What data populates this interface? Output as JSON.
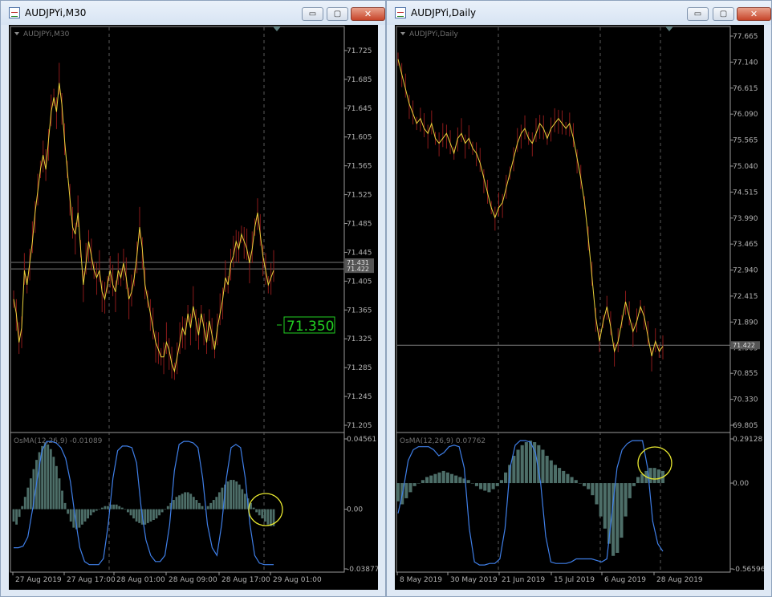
{
  "windows": [
    {
      "title": "AUDJPYi,M30",
      "label": "AUDJPYi,M30",
      "buttons": {
        "minimize": "▭",
        "maximize": "▢",
        "close": "✕"
      },
      "price_tag": "71.350",
      "chart_data": {
        "type": "line",
        "symbol": "AUDJPYi",
        "timeframe": "M30",
        "y_ticks": [
          "71.725",
          "71.685",
          "71.645",
          "71.605",
          "71.565",
          "71.525",
          "71.485",
          "71.445",
          "71.405",
          "71.365",
          "71.325",
          "71.285",
          "71.245",
          "71.205"
        ],
        "ylim": [
          71.205,
          71.745
        ],
        "x_ticks": [
          "27 Aug 2019",
          "27 Aug 17:00",
          "28 Aug 01:00",
          "28 Aug 09:00",
          "28 Aug 17:00",
          "29 Aug 01:00"
        ],
        "hlines": [
          {
            "value": 71.431,
            "label": "71.431"
          },
          {
            "value": 71.422,
            "label": "71.422"
          }
        ],
        "price_series": [
          71.38,
          71.36,
          71.32,
          71.34,
          71.42,
          71.4,
          71.43,
          71.46,
          71.5,
          71.53,
          71.56,
          71.58,
          71.56,
          71.6,
          71.64,
          71.66,
          71.64,
          71.68,
          71.65,
          71.6,
          71.56,
          71.52,
          71.48,
          71.47,
          71.5,
          71.45,
          71.4,
          71.43,
          71.46,
          71.44,
          71.42,
          71.41,
          71.42,
          71.39,
          71.38,
          71.4,
          71.42,
          71.4,
          71.39,
          71.42,
          71.41,
          71.43,
          71.41,
          71.38,
          71.39,
          71.41,
          71.44,
          71.48,
          71.45,
          71.4,
          71.38,
          71.36,
          71.34,
          71.32,
          71.31,
          71.3,
          71.3,
          71.32,
          71.31,
          71.29,
          71.28,
          71.3,
          71.32,
          71.34,
          71.33,
          71.36,
          71.34,
          71.37,
          71.35,
          71.33,
          71.36,
          71.34,
          71.32,
          71.35,
          71.33,
          71.31,
          71.34,
          71.36,
          71.38,
          71.41,
          71.4,
          71.43,
          71.44,
          71.46,
          71.45,
          71.47,
          71.46,
          71.45,
          71.43,
          71.45,
          71.48,
          71.5,
          71.47,
          71.44,
          71.42,
          71.4,
          71.41,
          71.42
        ],
        "osma": {
          "label": "OsMA(12,26,9) -0.01089",
          "y_ticks": [
            "0.04561",
            "0.00",
            "-0.03877"
          ],
          "ylim": [
            -0.03877,
            0.04561
          ],
          "histogram": [
            -0.008,
            -0.01,
            -0.005,
            0.002,
            0.008,
            0.014,
            0.02,
            0.026,
            0.032,
            0.037,
            0.041,
            0.043,
            0.042,
            0.039,
            0.034,
            0.028,
            0.02,
            0.012,
            0.004,
            -0.003,
            -0.008,
            -0.012,
            -0.013,
            -0.012,
            -0.01,
            -0.008,
            -0.006,
            -0.004,
            -0.002,
            -0.001,
            0.0,
            0.001,
            0.002,
            0.002,
            0.003,
            0.003,
            0.003,
            0.002,
            0.001,
            0.0,
            -0.002,
            -0.004,
            -0.006,
            -0.008,
            -0.009,
            -0.01,
            -0.01,
            -0.009,
            -0.008,
            -0.007,
            -0.006,
            -0.004,
            -0.002,
            0.0,
            0.002,
            0.004,
            0.006,
            0.008,
            0.009,
            0.01,
            0.011,
            0.011,
            0.01,
            0.008,
            0.006,
            0.004,
            0.002,
            0.0,
            0.002,
            0.004,
            0.006,
            0.008,
            0.011,
            0.014,
            0.016,
            0.018,
            0.019,
            0.019,
            0.018,
            0.016,
            0.013,
            0.01,
            0.007,
            0.004,
            0.001,
            -0.002,
            -0.004,
            -0.006,
            -0.008,
            -0.01,
            -0.011,
            -0.011
          ],
          "signal": [
            -0.025,
            -0.025,
            -0.024,
            -0.018,
            0.0,
            0.02,
            0.038,
            0.044,
            0.044,
            0.043,
            0.04,
            0.033,
            0.018,
            -0.005,
            -0.025,
            -0.034,
            -0.036,
            -0.036,
            -0.036,
            -0.032,
            -0.01,
            0.02,
            0.038,
            0.041,
            0.041,
            0.04,
            0.03,
            0.0,
            -0.02,
            -0.03,
            -0.034,
            -0.034,
            -0.03,
            -0.01,
            0.025,
            0.042,
            0.044,
            0.044,
            0.043,
            0.04,
            0.02,
            -0.01,
            -0.025,
            -0.03,
            -0.01,
            0.02,
            0.04,
            0.042,
            0.04,
            0.02,
            -0.01,
            -0.03,
            -0.035,
            -0.036,
            -0.036,
            -0.036
          ]
        }
      }
    },
    {
      "title": "AUDJPYi,Daily",
      "label": "AUDJPYi,Daily",
      "buttons": {
        "minimize": "▭",
        "maximize": "▢",
        "close": "✕"
      },
      "chart_data": {
        "type": "line",
        "symbol": "AUDJPYi",
        "timeframe": "Daily",
        "y_ticks": [
          "77.665",
          "77.140",
          "76.615",
          "76.090",
          "75.565",
          "75.040",
          "74.515",
          "73.990",
          "73.465",
          "72.940",
          "72.415",
          "71.890",
          "71.365",
          "70.855",
          "70.330",
          "69.805"
        ],
        "ylim": [
          69.805,
          77.665
        ],
        "x_ticks": [
          "8 May 2019",
          "30 May 2019",
          "21 Jun 2019",
          "15 Jul 2019",
          "6 Aug 2019",
          "28 Aug 2019"
        ],
        "hlines": [
          {
            "value": 71.422,
            "label": "71.422"
          }
        ],
        "price_series": [
          77.2,
          76.9,
          76.6,
          76.3,
          76.1,
          75.9,
          76.0,
          75.8,
          75.7,
          75.9,
          75.6,
          75.5,
          75.6,
          75.7,
          75.5,
          75.3,
          75.6,
          75.7,
          75.5,
          75.6,
          75.4,
          75.3,
          75.1,
          74.8,
          74.5,
          74.2,
          74.0,
          74.2,
          74.3,
          74.6,
          74.9,
          75.2,
          75.5,
          75.7,
          75.8,
          75.6,
          75.5,
          75.7,
          75.9,
          75.8,
          75.6,
          75.8,
          75.9,
          76.0,
          75.9,
          75.8,
          75.9,
          75.6,
          75.2,
          74.8,
          74.3,
          73.6,
          72.8,
          72.0,
          71.5,
          71.9,
          72.2,
          71.8,
          71.3,
          71.5,
          71.9,
          72.3,
          72.0,
          71.7,
          71.9,
          72.2,
          72.0,
          71.6,
          71.2,
          71.5,
          71.3,
          71.4
        ],
        "osma": {
          "label": "OsMA(12,26,9) 0.07762",
          "y_ticks": [
            "0.29128",
            "0.00",
            "-0.56596"
          ],
          "ylim": [
            -0.56596,
            0.29128
          ],
          "histogram": [
            -0.12,
            -0.14,
            -0.1,
            -0.06,
            -0.02,
            0.0,
            0.02,
            0.04,
            0.05,
            0.06,
            0.07,
            0.08,
            0.07,
            0.06,
            0.05,
            0.04,
            0.03,
            0.02,
            0.0,
            -0.02,
            -0.04,
            -0.05,
            -0.06,
            -0.04,
            -0.02,
            0.02,
            0.07,
            0.12,
            0.18,
            0.22,
            0.25,
            0.27,
            0.28,
            0.27,
            0.25,
            0.22,
            0.18,
            0.15,
            0.12,
            0.1,
            0.08,
            0.06,
            0.04,
            0.02,
            0.0,
            -0.02,
            -0.04,
            -0.08,
            -0.14,
            -0.22,
            -0.3,
            -0.4,
            -0.48,
            -0.46,
            -0.36,
            -0.22,
            -0.1,
            -0.02,
            0.04,
            0.06,
            0.08,
            0.1,
            0.1,
            0.09,
            0.08
          ],
          "signal": [
            -0.2,
            -0.05,
            0.15,
            0.22,
            0.24,
            0.24,
            0.24,
            0.22,
            0.18,
            0.2,
            0.24,
            0.25,
            0.24,
            0.1,
            -0.3,
            -0.52,
            -0.54,
            -0.54,
            -0.53,
            -0.53,
            -0.5,
            -0.3,
            0.1,
            0.25,
            0.28,
            0.28,
            0.27,
            0.2,
            0.0,
            -0.35,
            -0.52,
            -0.53,
            -0.53,
            -0.53,
            -0.52,
            -0.5,
            -0.5,
            -0.5,
            -0.5,
            -0.51,
            -0.52,
            -0.5,
            -0.2,
            0.1,
            0.22,
            0.26,
            0.28,
            0.28,
            0.28,
            0.1,
            -0.25,
            -0.4,
            -0.45
          ]
        }
      }
    }
  ]
}
